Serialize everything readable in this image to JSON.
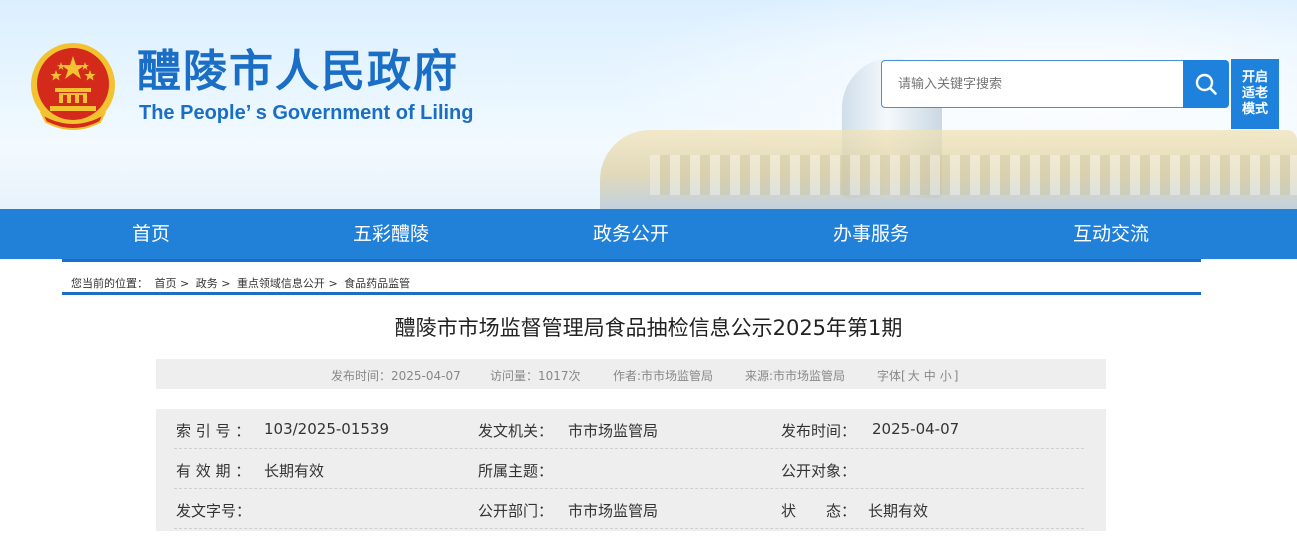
{
  "header": {
    "title_cn": "醴陵市人民政府",
    "title_en": "The People’ s Government of Liling",
    "search_placeholder": "请输入关键字搜索",
    "elder_mode": [
      "开启",
      "适老",
      "模式"
    ]
  },
  "nav": {
    "items": [
      "首页",
      "五彩醴陵",
      "政务公开",
      "办事服务",
      "互动交流"
    ]
  },
  "breadcrumb": {
    "prefix": "您当前的位置：",
    "items": [
      "首页",
      "政务",
      "重点领域信息公开",
      "食品药品监管"
    ],
    "separator": ">"
  },
  "article": {
    "title": "醴陵市市场监督管理局食品抽检信息公示2025年第1期",
    "meta": {
      "publish": "发布时间：2025-04-07",
      "views": "访问量：1017次",
      "author": "作者:市市场监管局",
      "source": "来源:市市场监管局",
      "font_prefix": "字体[",
      "font_large": "大",
      "font_medium": "中",
      "font_small": "小",
      "font_suffix": "]"
    }
  },
  "info": {
    "rows": [
      [
        {
          "label": "索 引 号 ：",
          "value": "103/2025-01539"
        },
        {
          "label": "发文机关：",
          "value": "市市场监管局"
        },
        {
          "label": "发布时间：",
          "value": "2025-04-07"
        }
      ],
      [
        {
          "label": "有 效 期 ：",
          "value": "长期有效"
        },
        {
          "label": "所属主题：",
          "value": ""
        },
        {
          "label": "公开对象：",
          "value": ""
        }
      ],
      [
        {
          "label": "发文字号：",
          "value": ""
        },
        {
          "label": "公开部门：",
          "value": "市市场监管局"
        },
        {
          "label": "状　　态：",
          "value": "长期有效"
        }
      ]
    ]
  },
  "colors": {
    "brand_blue": "#1a6ec6",
    "nav_blue": "#2180d8",
    "emblem_red": "#d42a1c",
    "emblem_gold": "#f2c230"
  }
}
